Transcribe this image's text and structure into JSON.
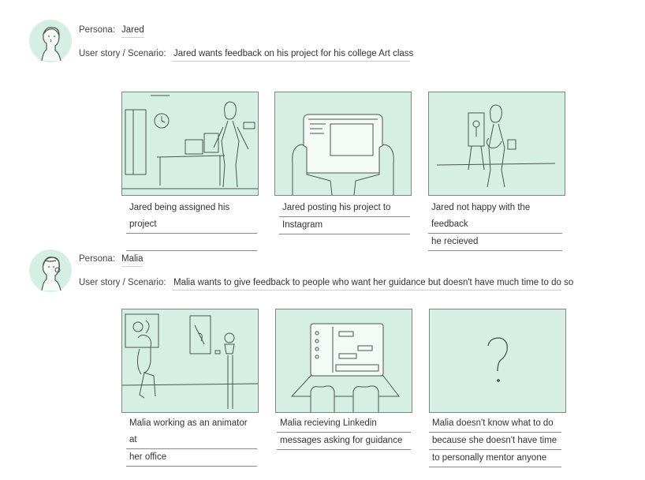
{
  "scenarios": [
    {
      "persona_label": "Persona:",
      "persona_name": "Jared",
      "story_label": "User story / Scenario:",
      "story": "Jared wants feedback on his project for his college Art class",
      "captions": [
        {
          "line1": "Jared being assigned his project",
          "line2": ""
        },
        {
          "line1": "Jared posting his project to",
          "line2": "Instagram"
        },
        {
          "line1": "Jared not happy with the feedback",
          "line2": "he recieved"
        }
      ]
    },
    {
      "persona_label": "Persona:",
      "persona_name": "Malia",
      "story_label": "User story / Scenario:",
      "story": "Malia wants to give feedback to people who want her guidance but doesn't have much time to do so",
      "captions": [
        {
          "line1": "Malia working as an animator at",
          "line2": "her office"
        },
        {
          "line1": "Malia recieving Linkedin",
          "line2": "messages asking for guidance"
        },
        {
          "line1": "Malia doesn't know what to do",
          "line2": "because she doesn't have time",
          "line3": "to personally mentor anyone"
        }
      ]
    }
  ],
  "colors": {
    "panel_fill": "#d6efe3",
    "sketch_stroke": "#4a5550"
  },
  "icons": [
    "jared-avatar-icon",
    "malia-avatar-icon",
    "question-mark-icon"
  ]
}
